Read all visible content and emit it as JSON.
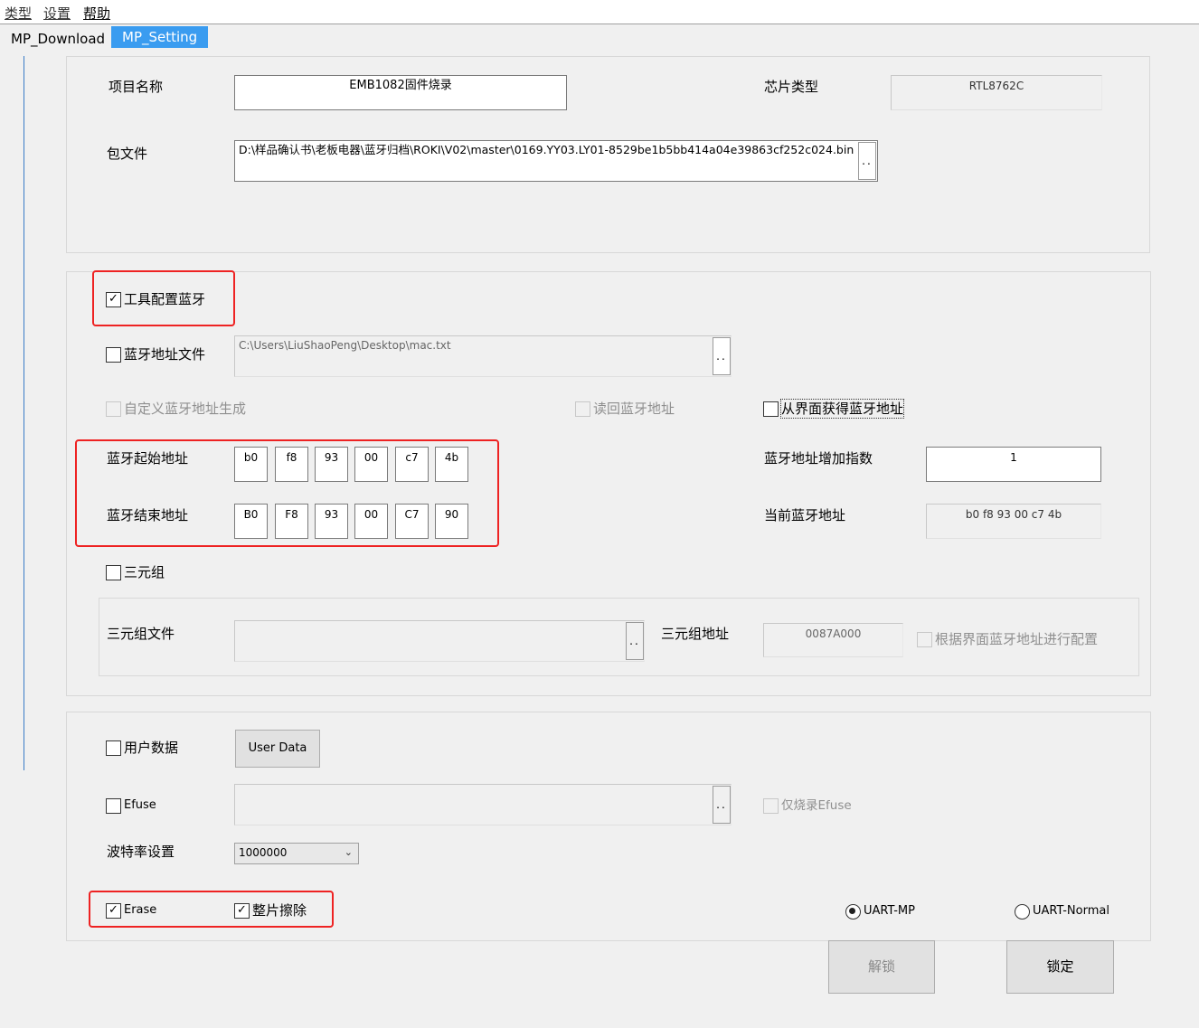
{
  "menu": {
    "type": "类型",
    "settings": "设置",
    "help": "帮助"
  },
  "tabs": {
    "download": "MP_Download",
    "setting": "MP_Setting"
  },
  "project": {
    "name_label": "项目名称",
    "name_value": "EMB1082固件烧录",
    "chip_label": "芯片类型",
    "chip_value": "RTL8762C",
    "package_label": "包文件",
    "package_value": "D:\\样品确认书\\老板电器\\蓝牙归档\\ROKI\\V02\\master\\0169.YY03.LY01-8529be1b5bb414a04e39863cf252c024.bin",
    "browse_label": ".."
  },
  "bt": {
    "tool_config_label": "工具配置蓝牙",
    "tool_config_checked": true,
    "addr_file_label": "蓝牙地址文件",
    "addr_file_value": "C:\\Users\\LiuShaoPeng\\Desktop\\mac.txt",
    "custom_gen_label": "自定义蓝牙地址生成",
    "read_back_label": "读回蓝牙地址",
    "from_ui_label": "从界面获得蓝牙地址",
    "start_label": "蓝牙起始地址",
    "start_bytes": [
      "b0",
      "f8",
      "93",
      "00",
      "c7",
      "4b"
    ],
    "end_label": "蓝牙结束地址",
    "end_bytes": [
      "B0",
      "F8",
      "93",
      "00",
      "C7",
      "90"
    ],
    "increment_label": "蓝牙地址增加指数",
    "increment_value": "1",
    "current_label": "当前蓝牙地址",
    "current_value": "b0 f8 93 00 c7 4b",
    "triple_label": "三元组",
    "triple_file_label": "三元组文件",
    "triple_addr_label": "三元组地址",
    "triple_addr_value": "0087A000",
    "config_by_ui_label": "根据界面蓝牙地址进行配置"
  },
  "misc": {
    "user_data_label": "用户数据",
    "user_data_button": "User Data",
    "efuse_label": "Efuse",
    "efuse_only_label": "仅烧录Efuse",
    "baud_label": "波特率设置",
    "baud_value": "1000000",
    "erase_label": "Erase",
    "erase_checked": true,
    "full_erase_label": "整片擦除",
    "full_erase_checked": true,
    "uart_mp_label": "UART-MP",
    "uart_normal_label": "UART-Normal",
    "selected_uart": "UART-MP"
  },
  "actions": {
    "unlock_label": "解锁",
    "lock_label": "锁定"
  },
  "colors": {
    "accent": "#3a9cf0",
    "highlight": "#ee2222",
    "background": "#f0f0f0"
  }
}
